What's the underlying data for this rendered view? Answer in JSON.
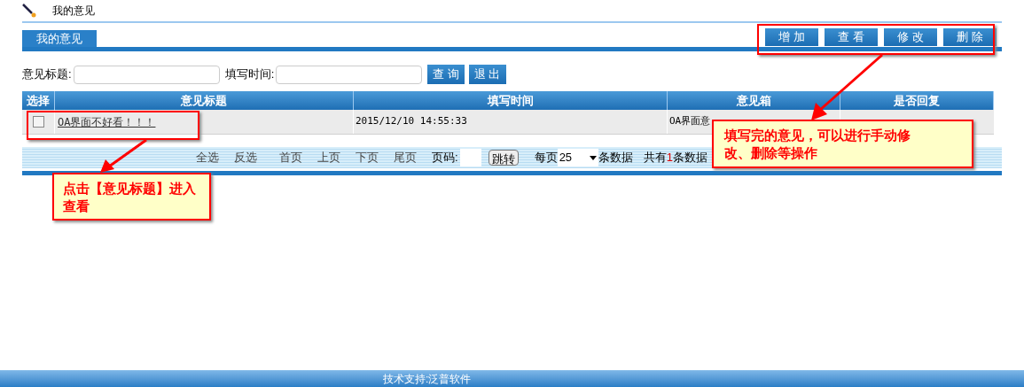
{
  "page_title": "我的意见",
  "tab": {
    "label": "我的意见",
    "selected": true
  },
  "actions": [
    "增 加",
    "查 看",
    "修 改",
    "删 除"
  ],
  "search": {
    "fields": [
      {
        "label": "意见标题:"
      },
      {
        "label": "填写时间:"
      }
    ],
    "buttons": [
      "查 询",
      "退 出"
    ]
  },
  "table": {
    "columns": [
      "选择",
      "意见标题",
      "填写时间",
      "意见箱",
      "是否回复"
    ],
    "rows": [
      {
        "checked": false,
        "title": "OA界面不好看！！！",
        "time": "2015/12/10 14:55:33",
        "box": "OA界面意"
      }
    ]
  },
  "pager": {
    "links": [
      "全选",
      "反选",
      "首页",
      "上页",
      "下页",
      "尾页"
    ],
    "page_label": "页码:",
    "jump": "跳转",
    "per_page_label": "每页",
    "per_page": "25",
    "records_label": "条数据",
    "total_prefix": "共有",
    "total": "1",
    "total_suffix": "条数据"
  },
  "annotations": [
    {
      "text": "点击【意见标题】进入查看"
    },
    {
      "text": "填写完的意见，可以进行手动修改、删除等操作"
    }
  ],
  "footer": "技术支持:泛普软件"
}
